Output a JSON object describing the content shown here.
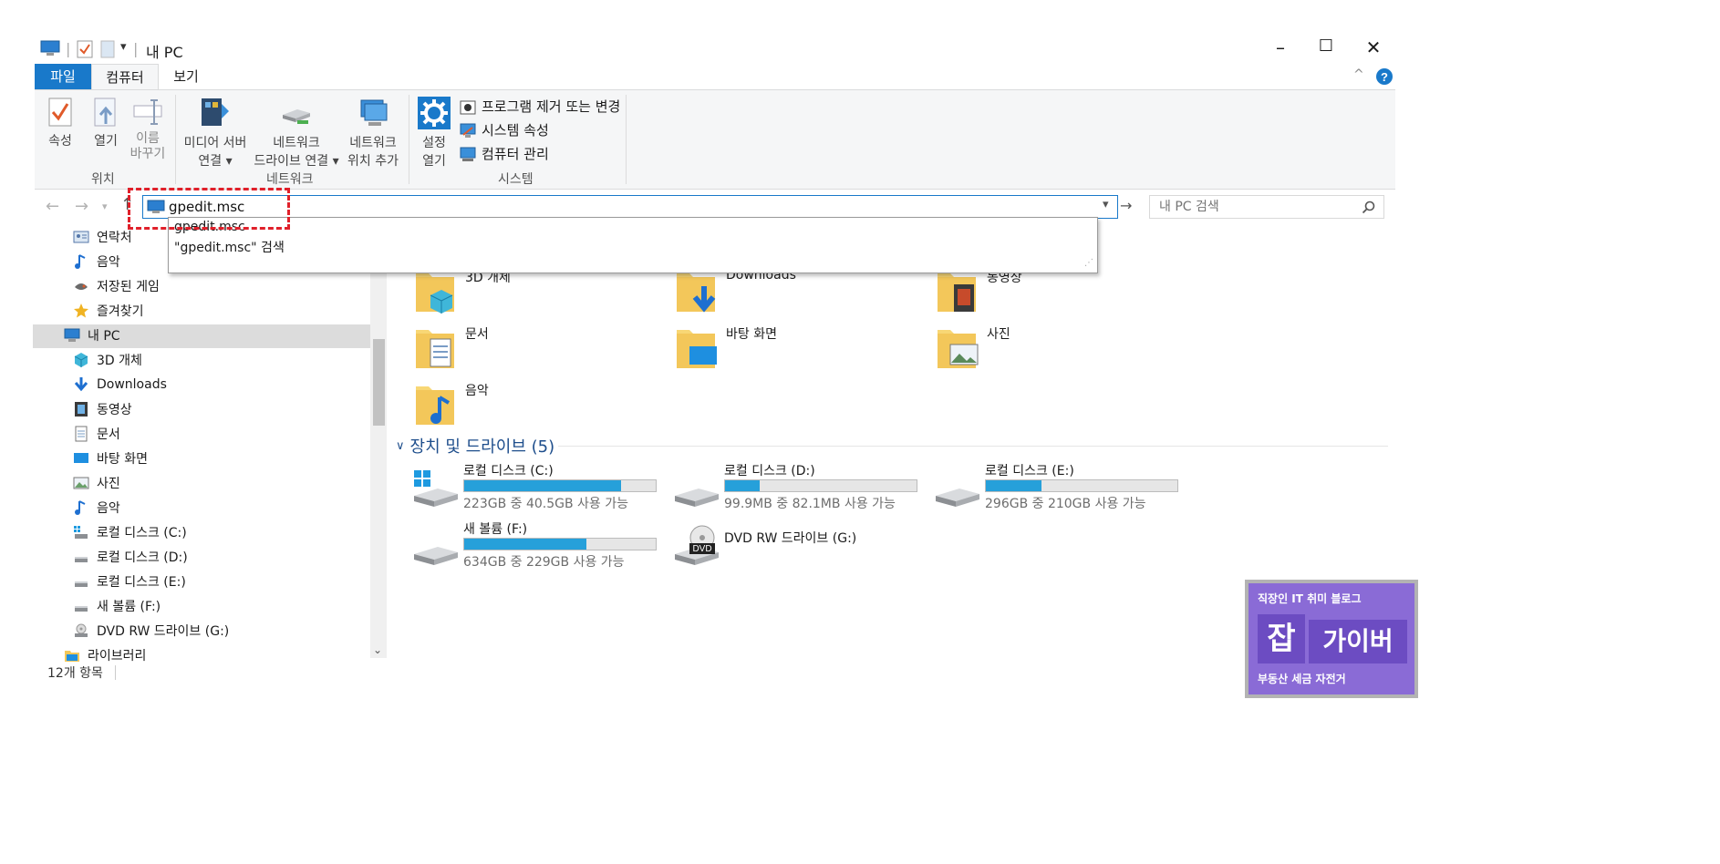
{
  "window": {
    "title": "내 PC",
    "controls": {
      "minimize": "–",
      "maximize": "☐",
      "close": "✕"
    }
  },
  "ribbon_tabs": [
    "파일",
    "컴퓨터",
    "보기"
  ],
  "ribbon": {
    "location_group": {
      "label": "위치",
      "buttons": [
        "속성",
        "열기",
        "이름\n바꾸기"
      ]
    },
    "network_group": {
      "label": "네트워크",
      "buttons": [
        {
          "line1": "미디어 서버",
          "line2": "연결 ▾"
        },
        {
          "line1": "네트워크",
          "line2": "드라이브 연결 ▾"
        },
        {
          "line1": "네트워크",
          "line2": "위치 추가"
        }
      ]
    },
    "system_group": {
      "label": "시스템",
      "settings": {
        "line1": "설정",
        "line2": "열기"
      },
      "items": [
        "프로그램 제거 또는 변경",
        "시스템 속성",
        "컴퓨터 관리"
      ]
    }
  },
  "address": {
    "value": "gpedit.msc",
    "search_placeholder": "내 PC 검색",
    "suggestions": [
      "gpedit.msc",
      "\"gpedit.msc\" 검색"
    ]
  },
  "nav_pane": [
    {
      "label": "연락처",
      "icon": "contacts-icon"
    },
    {
      "label": "음악",
      "icon": "music-icon"
    },
    {
      "label": "저장된 게임",
      "icon": "saved-games-icon"
    },
    {
      "label": "즐겨찾기",
      "icon": "star-icon"
    },
    {
      "label": "내 PC",
      "icon": "pc-icon",
      "selected": true
    },
    {
      "label": "3D 개체",
      "icon": "3d-objects-icon"
    },
    {
      "label": "Downloads",
      "icon": "download-icon"
    },
    {
      "label": "동영상",
      "icon": "video-icon"
    },
    {
      "label": "문서",
      "icon": "document-icon"
    },
    {
      "label": "바탕 화면",
      "icon": "desktop-icon"
    },
    {
      "label": "사진",
      "icon": "pictures-icon"
    },
    {
      "label": "음악",
      "icon": "music-icon"
    },
    {
      "label": "로컬 디스크 (C:)",
      "icon": "drive-c-icon"
    },
    {
      "label": "로컬 디스크 (D:)",
      "icon": "drive-icon"
    },
    {
      "label": "로컬 디스크 (E:)",
      "icon": "drive-icon"
    },
    {
      "label": "새 볼륨 (F:)",
      "icon": "drive-icon"
    },
    {
      "label": "DVD RW 드라이브 (G:)",
      "icon": "dvd-icon"
    },
    {
      "label": "라이브러리",
      "icon": "library-icon"
    }
  ],
  "folders": [
    {
      "label": "3D 개체",
      "icon": "3d-objects-folder-icon"
    },
    {
      "label": "Downloads",
      "icon": "downloads-folder-icon"
    },
    {
      "label": "동영상",
      "icon": "videos-folder-icon"
    },
    {
      "label": "문서",
      "icon": "documents-folder-icon"
    },
    {
      "label": "바탕 화면",
      "icon": "desktop-folder-icon"
    },
    {
      "label": "사진",
      "icon": "pictures-folder-icon"
    },
    {
      "label": "음악",
      "icon": "music-folder-icon"
    }
  ],
  "devices_section": {
    "title": "장치 및 드라이브 (5)"
  },
  "drives": [
    {
      "name": "로컬 디스크 (C:)",
      "free_text": "223GB 중 40.5GB 사용 가능",
      "used_fraction": 0.82,
      "icon": "windows-drive-icon"
    },
    {
      "name": "로컬 디스크 (D:)",
      "free_text": "99.9MB 중 82.1MB 사용 가능",
      "used_fraction": 0.18,
      "icon": "hard-drive-icon"
    },
    {
      "name": "로컬 디스크 (E:)",
      "free_text": "296GB 중 210GB 사용 가능",
      "used_fraction": 0.29,
      "icon": "hard-drive-icon"
    },
    {
      "name": "새 볼륨 (F:)",
      "free_text": "634GB 중 229GB 사용 가능",
      "used_fraction": 0.64,
      "icon": "hard-drive-icon"
    },
    {
      "name": "DVD RW 드라이브 (G:)",
      "icon": "dvd-drive-icon",
      "badge": "DVD"
    }
  ],
  "status_bar": {
    "item_count": "12개 항목"
  },
  "watermark": {
    "top": "직장인 IT 취미 블로그",
    "left": "잡",
    "right": "가이버",
    "bottom": "부동산 세금 자전거"
  },
  "colors": {
    "accent": "#1979ca",
    "drive_bar": "#26a0da",
    "highlight": "#e0202a",
    "watermark_bg": "#8a6bd6"
  }
}
